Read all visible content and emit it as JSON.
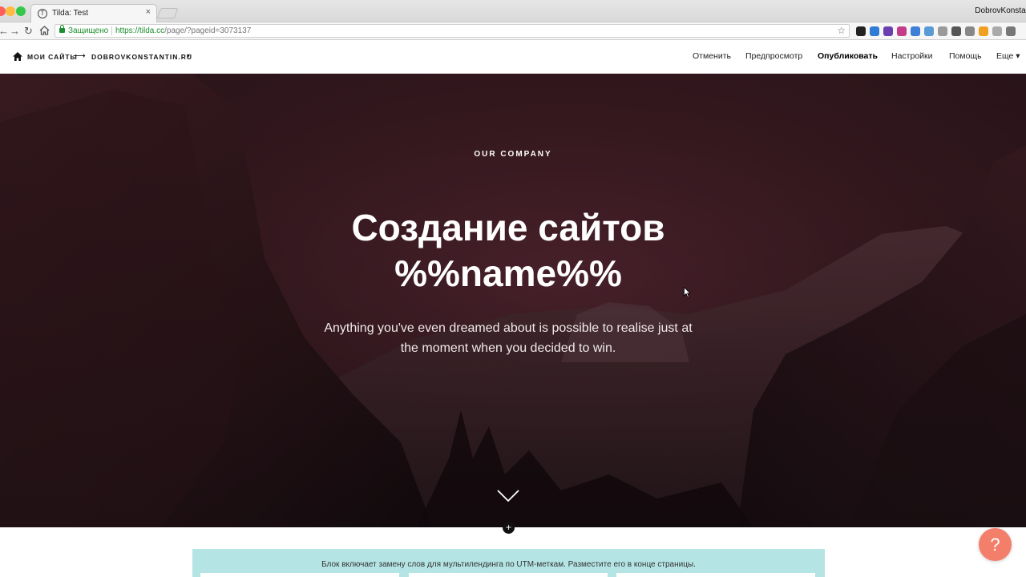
{
  "browser": {
    "tab_title": "Tilda: Test",
    "tab_close": "×",
    "profile_name": "DobrovKonstant",
    "secure_label": "Защищено",
    "url_host": "https://tilda.cc",
    "url_path": "/page/?pageid=3073137",
    "back": "←",
    "forward": "→",
    "reload": "↻",
    "star": "☆",
    "extensions": [
      "#222222",
      "#2f7bd6",
      "#6b3fb0",
      "#c43b8a",
      "#3e7fd8",
      "#5b9bd5",
      "#9a9a9a",
      "#555555",
      "#888888",
      "#f0a020",
      "#aaaaaa",
      "#777777"
    ]
  },
  "editor": {
    "my_sites": "МОИ САЙТЫ",
    "arrow": "⟶",
    "domain": "DOBROVKONSTANTIN.RU",
    "caret": "▾",
    "menu": {
      "cancel": "Отменить",
      "preview": "Предпросмотр",
      "publish": "Опубликовать",
      "settings": "Настройки",
      "help": "Помощь",
      "more": "Еще ▾"
    }
  },
  "hero": {
    "eyebrow": "OUR COMPANY",
    "title": "Создание сайтов %%name%%",
    "subtitle": "Anything you've even dreamed about is possible to realise just at the moment when you decided to win."
  },
  "add_block": "+",
  "info_block": {
    "text": "Блок включает замену слов для мультилендинга по UTM-меткам. Разместите его в конце страницы."
  },
  "help_button": "?"
}
